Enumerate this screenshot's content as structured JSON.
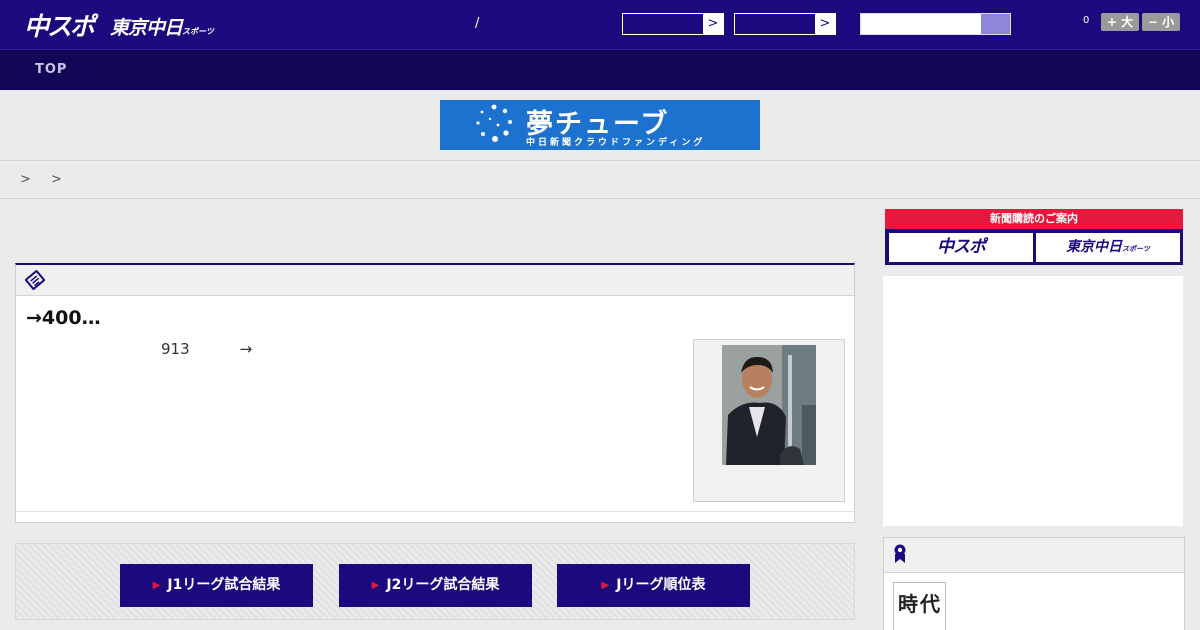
{
  "header": {
    "logo_chuspo": "中スポ",
    "logo_tokyo": "東京中日",
    "logo_tokyo_sub": "スポーツ",
    "slash": "/",
    "select_arrow": ">",
    "font_size_value": "0",
    "font_larger": "+ 大",
    "font_smaller": "− 小",
    "brand_color": "#1b0a7d"
  },
  "nav": {
    "top_label": "TOP"
  },
  "banner": {
    "title": "夢チューブ",
    "subtitle": "中日新聞クラウドファンディング"
  },
  "breadcrumb": "> >",
  "article": {
    "headline": "→400…",
    "lead_num": "913",
    "lead_arrow": "→",
    "icon": "newspaper-icon"
  },
  "league_buttons": [
    {
      "label": "J1リーグ試合結果"
    },
    {
      "label": "J2リーグ試合結果"
    },
    {
      "label": "Jリーグ順位表"
    }
  ],
  "sidebar": {
    "subscription_label": "新聞購読のご案内",
    "sub_chuspo": "中スポ",
    "sub_tokyo": "東京中日",
    "sub_tokyo_small": "スポーツ",
    "ranking_icon": "medal-icon",
    "jidai_text": "時代",
    "accent_red": "#e8173e"
  }
}
